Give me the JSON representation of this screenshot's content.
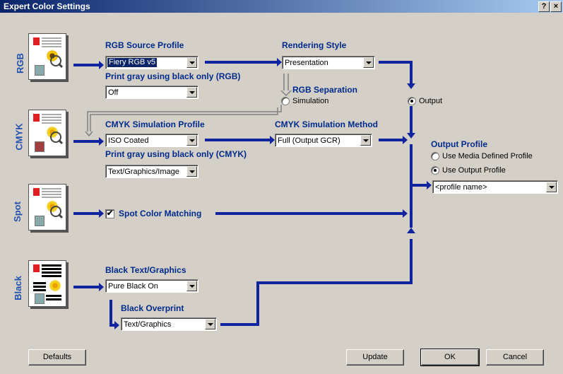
{
  "window": {
    "title": "Expert Color Settings",
    "help_glyph": "?",
    "close_glyph": "×"
  },
  "rows": {
    "rgb": "RGB",
    "cmyk": "CMYK",
    "spot": "Spot",
    "black": "Black"
  },
  "rgb": {
    "source_profile_label": "RGB Source Profile",
    "source_profile_value": "Fiery RGB v5",
    "gray_label": "Print gray using black only (RGB)",
    "gray_value": "Off"
  },
  "rendering": {
    "label": "Rendering Style",
    "value": "Presentation"
  },
  "separation": {
    "label": "RGB Separation",
    "simulation": "Simulation",
    "output": "Output",
    "selected": "output"
  },
  "cmyk": {
    "sim_profile_label": "CMYK Simulation Profile",
    "sim_profile_value": "ISO Coated",
    "gray_label": "Print gray using black only (CMYK)",
    "gray_value": "Text/Graphics/Image",
    "method_label": "CMYK Simulation Method",
    "method_value": "Full (Output GCR)"
  },
  "output_profile": {
    "label": "Output Profile",
    "use_media": "Use Media Defined Profile",
    "use_output": "Use Output Profile",
    "selected": "use_output",
    "value": "<profile name>"
  },
  "spot": {
    "label": "Spot Color Matching",
    "checked": true,
    "check_glyph": "✔"
  },
  "black": {
    "text_graphics_label": "Black Text/Graphics",
    "text_graphics_value": "Pure Black On",
    "overprint_label": "Black Overprint",
    "overprint_value": "Text/Graphics"
  },
  "buttons": {
    "defaults": "Defaults",
    "update": "Update",
    "ok": "OK",
    "cancel": "Cancel"
  },
  "colors": {
    "link": "#1024a0",
    "label": "#002a8c",
    "title_bar": "#0a246a"
  }
}
